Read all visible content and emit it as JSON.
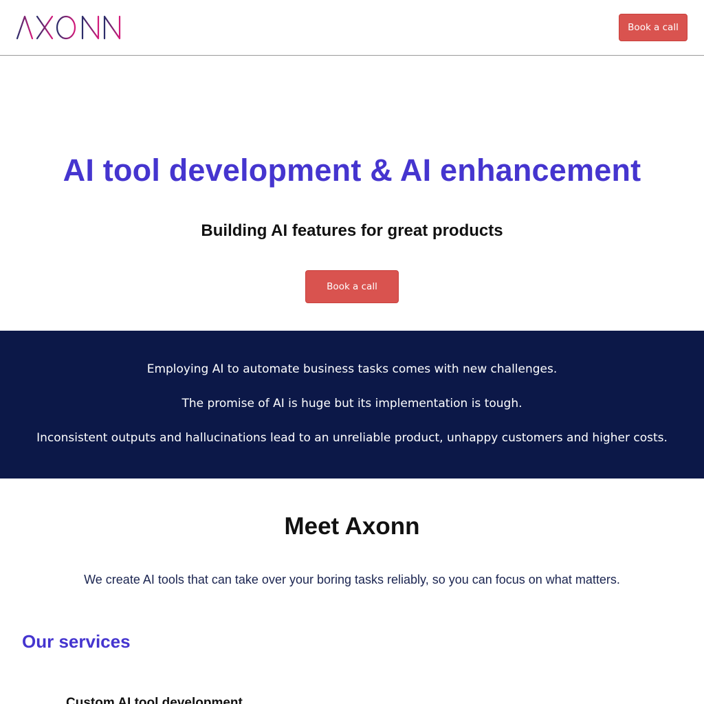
{
  "header": {
    "logo_text": "AXONN",
    "cta_label": "Book a call"
  },
  "hero": {
    "title": "AI tool development & AI enhancement",
    "subtitle": "Building AI features for great products",
    "cta_label": "Book a call"
  },
  "challenges": {
    "lines": [
      "Employing AI to automate business tasks comes with new challenges.",
      "The promise of AI is huge but its implementation is tough.",
      "Inconsistent outputs and hallucinations lead to an unreliable product, unhappy customers and higher costs."
    ]
  },
  "meet": {
    "title": "Meet Axonn",
    "text": "We create AI tools that can take over your boring tasks reliably, so you can focus on what matters."
  },
  "services": {
    "title": "Our services",
    "items": [
      "Custom AI tool development"
    ]
  },
  "colors": {
    "accent": "#4535cf",
    "cta": "#d9534f",
    "band": "#0c1848",
    "logo_start": "#2a2d6a",
    "logo_end": "#d4197a"
  }
}
